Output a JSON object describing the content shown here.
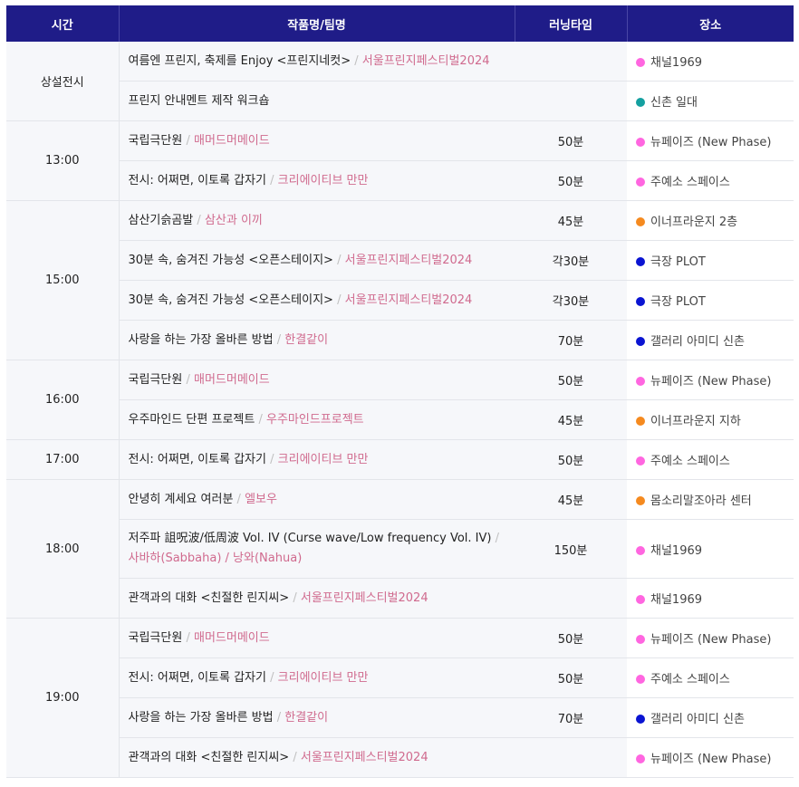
{
  "header": {
    "time": "시간",
    "title": "작품명/팀명",
    "runtime": "러닝타임",
    "venue": "장소"
  },
  "separator": "/",
  "colors": {
    "header_bg": "#1f1c88",
    "team_text": "#d06a8e",
    "venue_pink": "#ff66e0",
    "venue_teal": "#14a0a0",
    "venue_orange": "#f58a1f",
    "venue_blue": "#0a14d2"
  },
  "groups": [
    {
      "time": "상설전시",
      "rows": [
        {
          "title": "여름엔 프린지, 축제를 Enjoy <프린지네컷>",
          "team": "서울프린지페스티벌2024",
          "runtime": "",
          "venue": "채널1969",
          "venue_color": "pink"
        },
        {
          "title": "프린지 안내멘트 제작 워크숍",
          "team": "",
          "runtime": "",
          "venue": "신촌 일대",
          "venue_color": "teal"
        }
      ]
    },
    {
      "time": "13:00",
      "rows": [
        {
          "title": "국립극단원",
          "team": "매머드머메이드",
          "runtime": "50분",
          "venue": "뉴페이즈 (New Phase)",
          "venue_color": "pink"
        },
        {
          "title": "전시: 어쩌면, 이토록 갑자기",
          "team": "크리에이티브 만만",
          "runtime": "50분",
          "venue": "주예소 스페이스",
          "venue_color": "pink"
        }
      ]
    },
    {
      "time": "15:00",
      "rows": [
        {
          "title": "삼산기슭곰발",
          "team": "삼산과 이끼",
          "runtime": "45분",
          "venue": "이너프라운지 2층",
          "venue_color": "orange"
        },
        {
          "title": "30분 속, 숨겨진 가능성 <오픈스테이지>",
          "team": "서울프린지페스티벌2024",
          "runtime": "각30분",
          "venue": "극장 PLOT",
          "venue_color": "blue"
        },
        {
          "title": "30분 속, 숨겨진 가능성 <오픈스테이지>",
          "team": "서울프린지페스티벌2024",
          "runtime": "각30분",
          "venue": "극장 PLOT",
          "venue_color": "blue"
        },
        {
          "title": "사랑을 하는 가장 올바른 방법",
          "team": "한결같이",
          "runtime": "70분",
          "venue": "갤러리 아미디 신촌",
          "venue_color": "blue"
        }
      ]
    },
    {
      "time": "16:00",
      "rows": [
        {
          "title": "국립극단원",
          "team": "매머드머메이드",
          "runtime": "50분",
          "venue": "뉴페이즈 (New Phase)",
          "venue_color": "pink"
        },
        {
          "title": "우주마인드 단편 프로젝트",
          "team": "우주마인드프로젝트",
          "runtime": "45분",
          "venue": "이너프라운지 지하",
          "venue_color": "orange"
        }
      ]
    },
    {
      "time": "17:00",
      "rows": [
        {
          "title": "전시: 어쩌면, 이토록 갑자기",
          "team": "크리에이티브 만만",
          "runtime": "50분",
          "venue": "주예소 스페이스",
          "venue_color": "pink"
        }
      ]
    },
    {
      "time": "18:00",
      "rows": [
        {
          "title": "안녕히 계세요 여러분",
          "team": "엘보우",
          "runtime": "45분",
          "venue": "몸소리말조아라 센터",
          "venue_color": "orange"
        },
        {
          "title": "저주파 詛呪波/低周波 Vol. IV (Curse wave/Low frequency Vol. IV)",
          "team": "사바하(Sabbaha) / 낭와(Nahua)",
          "runtime": "150분",
          "venue": "채널1969",
          "venue_color": "pink",
          "tall": true
        },
        {
          "title": "관객과의 대화 <친절한 린지씨>",
          "team": "서울프린지페스티벌2024",
          "runtime": "",
          "venue": "채널1969",
          "venue_color": "pink"
        }
      ]
    },
    {
      "time": "19:00",
      "rows": [
        {
          "title": "국립극단원",
          "team": "매머드머메이드",
          "runtime": "50분",
          "venue": "뉴페이즈 (New Phase)",
          "venue_color": "pink"
        },
        {
          "title": "전시: 어쩌면, 이토록 갑자기",
          "team": "크리에이티브 만만",
          "runtime": "50분",
          "venue": "주예소 스페이스",
          "venue_color": "pink"
        },
        {
          "title": "사랑을 하는 가장 올바른 방법",
          "team": "한결같이",
          "runtime": "70분",
          "venue": "갤러리 아미디 신촌",
          "venue_color": "blue"
        },
        {
          "title": "관객과의 대화 <친절한 린지씨>",
          "team": "서울프린지페스티벌2024",
          "runtime": "",
          "venue": "뉴페이즈 (New Phase)",
          "venue_color": "pink"
        }
      ]
    }
  ]
}
